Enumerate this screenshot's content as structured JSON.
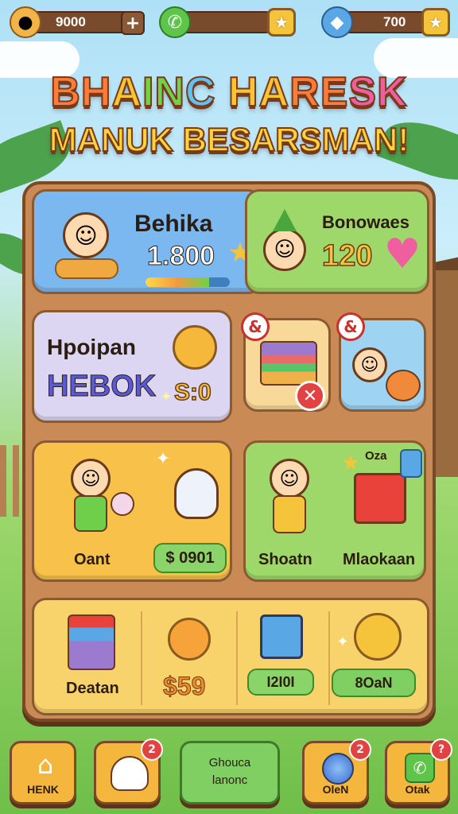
{
  "resources": {
    "coins": {
      "value": "9000",
      "icon": "cookie-icon",
      "plus": "+"
    },
    "energy": {
      "icon": "phone-icon",
      "star": "★"
    },
    "gems": {
      "value": "700",
      "icon": "gem-icon",
      "star": "★"
    }
  },
  "title": {
    "line1": [
      "BH",
      "A",
      "IN",
      "C ",
      "HA",
      "RE",
      "SK"
    ],
    "line2": "MANUK BESARSMAN!"
  },
  "profile_card": {
    "name": "Behika",
    "score": "1.800",
    "progress": 0.75,
    "star": "★"
  },
  "bonus_card": {
    "label": "Bonowaes",
    "value": "120",
    "heart": "♥"
  },
  "offer_card": {
    "label": "Hpoipan",
    "code": "HEBOK",
    "price": "S:0",
    "sparkle": "✦"
  },
  "mini_cards": [
    {
      "badge": "&",
      "close": "✕"
    },
    {
      "badge": "&"
    }
  ],
  "character_cards": [
    {
      "label": "Oant",
      "price": "$ 0901",
      "sparkle": "✦"
    },
    {
      "label": "Shoatn",
      "label2": "Mlaokaan",
      "tag": "Oza",
      "star": "★"
    }
  ],
  "shop_row": {
    "item1": "Deatan",
    "item2": "$59",
    "item3": "I2I0I",
    "item4": "8OaN",
    "sparkle": "✦"
  },
  "bottom_nav": [
    {
      "label": "HENK",
      "icon": "home-icon",
      "badge": ""
    },
    {
      "label": "",
      "icon": "ghost-icon",
      "badge": "2"
    },
    {
      "label_top": "Ghouca",
      "label_bottom": "lanonc",
      "icon": "",
      "badge": ""
    },
    {
      "label": "OleN",
      "icon": "orb-icon",
      "badge": "2"
    },
    {
      "label": "Otak",
      "icon": "phone-box-icon",
      "badge": "?"
    }
  ],
  "colors": {
    "card_blue": "#7cb8f0",
    "card_green": "#9fd86a",
    "card_lavender": "#dcd6f3",
    "card_yellow": "#f8c24a",
    "nav_green": "#7fcf62"
  }
}
